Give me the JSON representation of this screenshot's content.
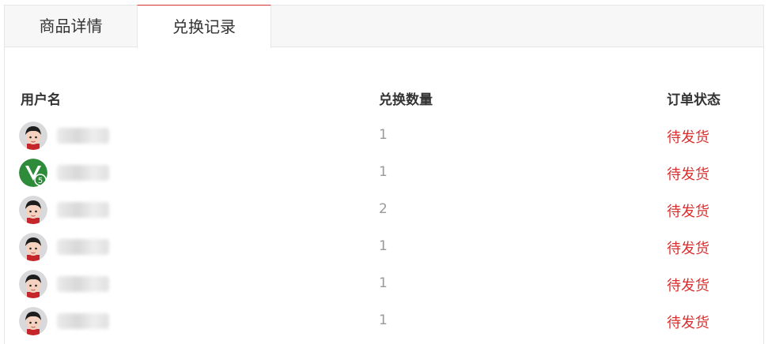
{
  "tabs": [
    {
      "label": "商品详情"
    },
    {
      "label": "兑换记录"
    }
  ],
  "table": {
    "headers": {
      "user": "用户名",
      "qty": "兑换数量",
      "status": "订单状态"
    },
    "rows": [
      {
        "avatar": "boy-avatar-icon",
        "qty": "1",
        "status": "待发货"
      },
      {
        "avatar": "v5-badge-avatar-icon",
        "qty": "1",
        "status": "待发货"
      },
      {
        "avatar": "boy-avatar-icon",
        "qty": "2",
        "status": "待发货"
      },
      {
        "avatar": "boy-avatar-icon",
        "qty": "1",
        "status": "待发货"
      },
      {
        "avatar": "boy-avatar-icon",
        "qty": "1",
        "status": "待发货"
      },
      {
        "avatar": "boy-avatar-icon",
        "qty": "1",
        "status": "待发货"
      }
    ]
  },
  "colors": {
    "accent": "#d9302f",
    "muted": "#999999",
    "text": "#333333",
    "avatar_green": "#2e8b3a"
  }
}
